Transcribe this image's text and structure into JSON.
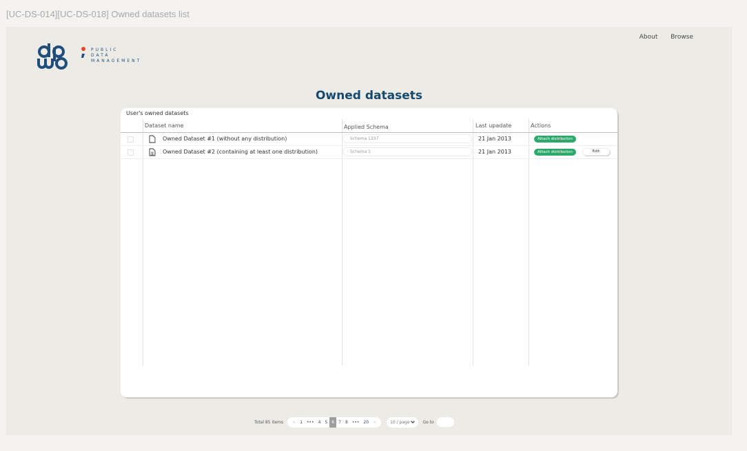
{
  "frame_title": "[UC-DS-014][UC-DS-018] Owned datasets list",
  "nav": {
    "about": "About",
    "browse": "Browse"
  },
  "logo": {
    "line1": "PUBLIC",
    "line2": "DATA",
    "line3": "MANAGEMENT"
  },
  "page_title": "Owned datasets",
  "table": {
    "caption": "User's owned datasets",
    "columns": [
      "Dataset name",
      "Applied Schema",
      "Last upadate",
      "Actions"
    ],
    "rows": [
      {
        "name": "Owned Dataset #1 (without any distribution)",
        "schema": "Schema 1337",
        "updated": "21 Jan 2013",
        "attach": "Attach distribution",
        "edit": ""
      },
      {
        "name": "Owned Dataset #2 (containing at least one distribution)",
        "schema": "Schema 1",
        "updated": "21 Jan 2013",
        "attach": "Attach distribution",
        "edit": "Edit"
      }
    ]
  },
  "pagination": {
    "total": "Total 85 items",
    "prev": "<",
    "next": ">",
    "pages": [
      "1",
      "•••",
      "4",
      "5",
      "6",
      "7",
      "8",
      "•••",
      "20"
    ],
    "active": "6",
    "page_size": "10 / page",
    "goto": "Go to"
  }
}
